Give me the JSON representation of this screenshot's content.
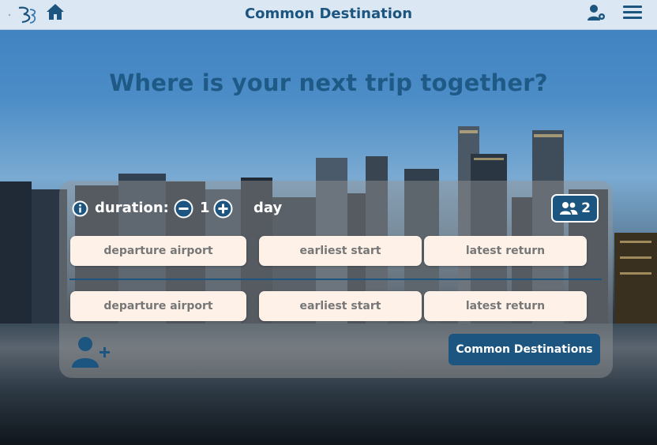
{
  "header": {
    "title": "Common Destination",
    "icons": [
      "logo",
      "home-icon",
      "user-settings-icon",
      "menu-icon"
    ]
  },
  "main": {
    "headline": "Where is your next trip together?"
  },
  "search_panel": {
    "duration_label": "duration:",
    "duration_value": "1",
    "duration_unit": "day",
    "travelers_count": "2",
    "travelers": [
      {
        "departure_placeholder": "departure airport",
        "start_placeholder": "earliest start",
        "return_placeholder": "latest return"
      },
      {
        "departure_placeholder": "departure airport",
        "start_placeholder": "earliest start",
        "return_placeholder": "latest return"
      }
    ],
    "submit_label": "Common Destinations"
  },
  "colors": {
    "brand": "#1c557f",
    "field_bg": "#fdf1e8",
    "header_bg": "#dbe7f2"
  }
}
